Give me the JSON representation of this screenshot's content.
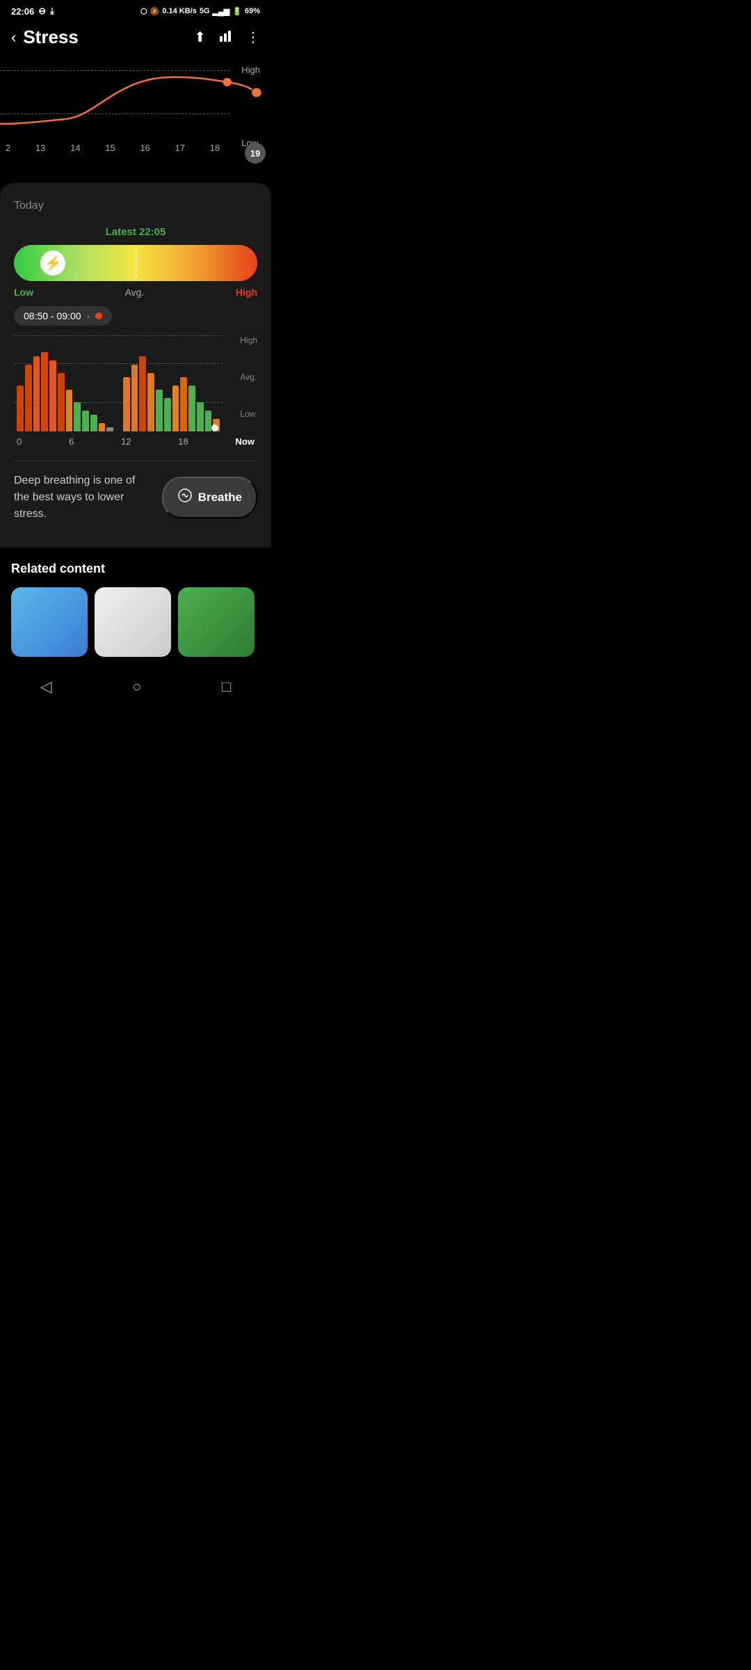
{
  "statusBar": {
    "time": "22:06",
    "battery": "69%",
    "network": "5G",
    "signal": "0.14 KB/s"
  },
  "header": {
    "title": "Stress",
    "backLabel": "‹",
    "shareIcon": "share",
    "chartIcon": "bar-chart",
    "moreIcon": "more"
  },
  "trendChart": {
    "yLabels": [
      "High",
      "Low"
    ],
    "xLabels": [
      "2",
      "13",
      "14",
      "15",
      "16",
      "17",
      "18",
      "19"
    ]
  },
  "today": {
    "label": "Today",
    "latestTime": "Latest 22:05",
    "stressBar": {
      "lowLabel": "Low",
      "avgLabel": "Avg.",
      "highLabel": "High"
    },
    "timeRange": "08:50 - 09:00",
    "chartXLabels": [
      "0",
      "6",
      "12",
      "18",
      "Now"
    ],
    "chartYLabels": [
      "High",
      "Avg.",
      "Low"
    ]
  },
  "breathe": {
    "description": "Deep breathing is one of the best ways to lower stress.",
    "buttonLabel": "Breathe"
  },
  "relatedContent": {
    "title": "Related content"
  },
  "bottomNav": {
    "back": "◁",
    "home": "○",
    "recents": "□"
  }
}
